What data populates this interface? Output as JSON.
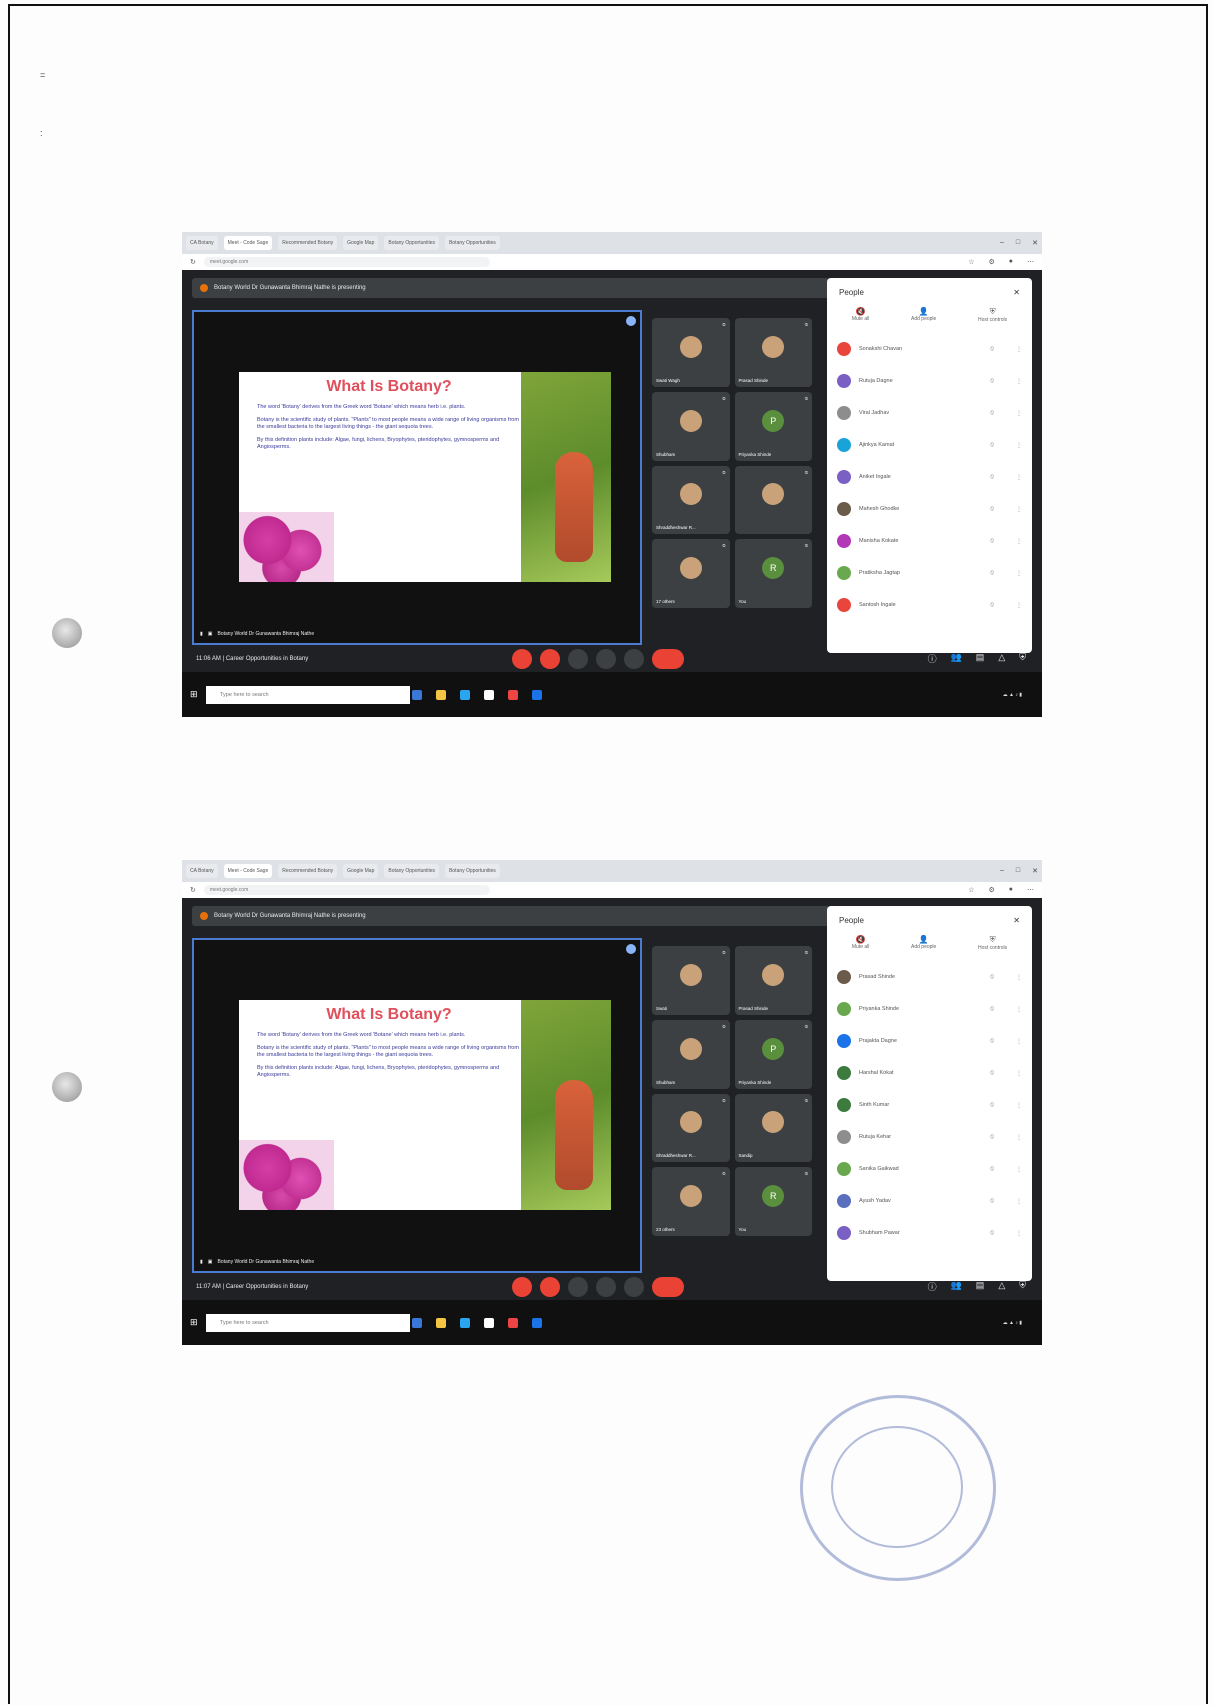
{
  "page": {
    "corner_mark": "=",
    "side_mark": ":"
  },
  "screens": [
    {
      "browser_tabs": [
        "CA Botany",
        "Meet - Code Sage",
        "Recommended Botany",
        "Google Map",
        "Botany Opportunities",
        "Botany Opportunities"
      ],
      "address": "meet.google.com",
      "presenting_banner": "Botany World Dr Gunawanta Bhimraj Nathe is presenting",
      "slide": {
        "title": "What Is Botany?",
        "bullets": [
          "The word 'Botany' derives from the Greek word 'Botane' which means herb i.e. plants.",
          "Botany is the scientific study of plants. \"Plants\" to most people means a wide range of living organisms from the smallest bacteria to the largest living things - the giant sequoia trees.",
          "By this definition plants include: Algae, fungi, lichens, Bryophytes, pteridophytes, gymnosperms and Angiosperms."
        ]
      },
      "main_tile_label": "Botany World Dr Gunawanta Bhimraj Nathe",
      "participants": [
        {
          "name": "Swati Wagh",
          "initial": ""
        },
        {
          "name": "Prasad Shinde",
          "initial": ""
        },
        {
          "name": "Shubham",
          "initial": ""
        },
        {
          "name": "Priyanka Shinde",
          "initial": "P"
        },
        {
          "name": "Shraddheshwar R...",
          "initial": ""
        },
        {
          "name": "",
          "initial": ""
        },
        {
          "name": "17 others",
          "initial": ""
        },
        {
          "name": "You",
          "initial": "R"
        }
      ],
      "people_panel": {
        "title": "People",
        "actions": [
          "Mute all",
          "Add people",
          "Host controls"
        ],
        "list": [
          {
            "name": "Sonakshi Chavan",
            "color": "#e8453c"
          },
          {
            "name": "Rutuja Dagne",
            "color": "#7a5fc5"
          },
          {
            "name": "Viral Jadhav",
            "color": "#8d8d8d"
          },
          {
            "name": "Ajinkya Kamat",
            "color": "#1aa3d9"
          },
          {
            "name": "Aniket Ingale",
            "color": "#7a5fc5"
          },
          {
            "name": "Mahesh Ghodke",
            "color": "#6b5b4a"
          },
          {
            "name": "Manisha Kokate",
            "color": "#b338b8"
          },
          {
            "name": "Pratiksha Jagtap",
            "color": "#6aa84f"
          },
          {
            "name": "Santosh Ingale",
            "color": "#e8453c"
          }
        ]
      },
      "meeting_time": "11:06 AM",
      "meeting_title": "Career Opportunities in Botany",
      "taskbar_search": "Type here to search"
    },
    {
      "browser_tabs": [
        "CA Botany",
        "Meet - Code Sage",
        "Recommended Botany",
        "Google Map",
        "Botany Opportunities",
        "Botany Opportunities"
      ],
      "address": "meet.google.com",
      "presenting_banner": "Botany World Dr Gunawanta Bhimraj Nathe is presenting",
      "slide": {
        "title": "What Is Botany?",
        "bullets": [
          "The word 'Botany' derives from the Greek word 'Botane' which means herb i.e. plants.",
          "Botany is the scientific study of plants. \"Plants\" to most people means a wide range of living organisms from the smallest bacteria to the largest living things - the giant sequoia trees.",
          "By this definition plants include: Algae, fungi, lichens, Bryophytes, pteridophytes, gymnosperms and Angiosperms."
        ]
      },
      "main_tile_label": "Botany World Dr Gunawanta Bhimraj Nathe",
      "participants": [
        {
          "name": "Swati",
          "initial": ""
        },
        {
          "name": "Prasad Shinde",
          "initial": ""
        },
        {
          "name": "Shubham",
          "initial": ""
        },
        {
          "name": "Priyanka Shinde",
          "initial": "P"
        },
        {
          "name": "Shraddheshwar R...",
          "initial": ""
        },
        {
          "name": "Sandip",
          "initial": ""
        },
        {
          "name": "23 others",
          "initial": ""
        },
        {
          "name": "You",
          "initial": "R"
        }
      ],
      "people_panel": {
        "title": "People",
        "actions": [
          "Mute all",
          "Add people",
          "Host controls"
        ],
        "list": [
          {
            "name": "Prasad Shinde",
            "color": "#6b5b4a"
          },
          {
            "name": "Priyanka Shinde",
            "color": "#6aa84f"
          },
          {
            "name": "Prajakta Dagne",
            "color": "#1a73e8"
          },
          {
            "name": "Harshal Kokat",
            "color": "#3d7a3d"
          },
          {
            "name": "Sinth Kumar",
            "color": "#3d7a3d"
          },
          {
            "name": "Rutuja Kehar",
            "color": "#8d8d8d"
          },
          {
            "name": "Sanika Gaikwad",
            "color": "#6aa84f"
          },
          {
            "name": "Ayush Yadav",
            "color": "#5b6fbf"
          },
          {
            "name": "Shubham Pawar",
            "color": "#7a5fc5"
          }
        ]
      },
      "meeting_time": "11:07 AM",
      "meeting_title": "Career Opportunities in Botany",
      "taskbar_search": "Type here to search"
    }
  ]
}
